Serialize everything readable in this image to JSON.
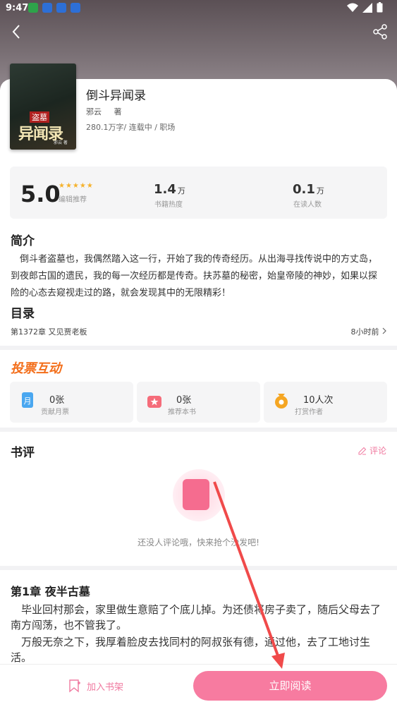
{
  "status_bar": {
    "time": "9:47"
  },
  "book": {
    "title": "倒斗异闻录",
    "author": "邪云",
    "author_suffix": "著",
    "meta": "280.1万字/  连载中  /  职场",
    "cover": {
      "tag": "盗墓",
      "title": "异闻录",
      "author": "邪云 著"
    }
  },
  "stats": {
    "score": "5.0",
    "stars": "★★★★★",
    "score_label": "编辑推荐",
    "heat_value": "1.4",
    "heat_unit": "万",
    "heat_label": "书籍热度",
    "readers_value": "0.1",
    "readers_unit": "万",
    "readers_label": "在读人数"
  },
  "intro": {
    "heading": "简介",
    "text": "倒斗者盗墓也，我偶然踏入这一行，开始了我的传奇经历。从出海寻找传说中的方丈岛，到夜郎古国的遗民，我的每一次经历都是传奇。扶苏墓的秘密，始皇帝陵的神妙，如果以探险的心态去窥视走过的路，就会发现其中的无限精彩！"
  },
  "toc": {
    "heading": "目录",
    "latest": "第1372章 又见贾老板",
    "time": "8小时前"
  },
  "vote": {
    "title": "投票互动",
    "cards": [
      {
        "count": "0张",
        "label": "贡献月票",
        "icon": "monthly-ticket-icon"
      },
      {
        "count": "0张",
        "label": "推荐本书",
        "icon": "recommend-gift-icon"
      },
      {
        "count": "10人次",
        "label": "打赏作者",
        "icon": "coin-bag-icon"
      }
    ]
  },
  "reviews": {
    "heading": "书评",
    "comment_label": "评论",
    "empty_text": "还没人评论哦，快来抢个沙发吧!"
  },
  "chapter": {
    "title": "第1章 夜半古墓",
    "p1": "毕业回村那会，家里做生意赔了个底儿掉。为还债将房子卖了，随后父母去了南方闯荡，也不管我了。",
    "p2": "万般无奈之下，我厚着脸皮去找同村的阿叔张有德，通过他，去了工地讨生活。"
  },
  "bottom": {
    "shelf_label": "加入书架",
    "read_label": "立即阅读"
  },
  "colors": {
    "accent_pink": "#f77ba0",
    "vote_orange": "#f36e1a",
    "star": "#f5b22d"
  }
}
